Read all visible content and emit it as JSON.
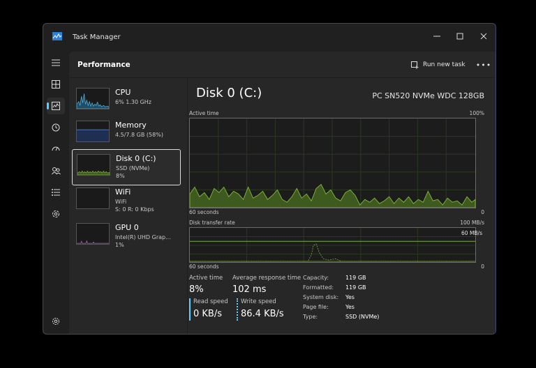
{
  "app": {
    "title": "Task Manager"
  },
  "header": {
    "page_title": "Performance",
    "run_new_task": "Run new task"
  },
  "resources": [
    {
      "name": "CPU",
      "sub1": "6% 1.30 GHz",
      "sub2": ""
    },
    {
      "name": "Memory",
      "sub1": "4.5/7.8 GB (58%)",
      "sub2": ""
    },
    {
      "name": "Disk 0 (C:)",
      "sub1": "SSD (NVMe)",
      "sub2": "8%"
    },
    {
      "name": "WiFi",
      "sub1": "WiFi",
      "sub2": "S: 0 R: 0 Kbps"
    },
    {
      "name": "GPU 0",
      "sub1": "Intel(R) UHD Grap...",
      "sub2": "1%"
    }
  ],
  "detail": {
    "title": "Disk 0 (C:)",
    "model": "PC SN520 NVMe WDC 128GB",
    "active_time_graph": {
      "label": "Active time",
      "max": "100%",
      "time": "60 seconds",
      "min": "0"
    },
    "transfer_graph": {
      "label": "Disk transfer rate",
      "max": "100 MB/s",
      "ref": "60 MB/s",
      "time": "60 seconds",
      "min": "0"
    },
    "stats": {
      "active_time_label": "Active time",
      "active_time": "8%",
      "avg_response_label": "Average response time",
      "avg_response": "102 ms",
      "read_speed_label": "Read speed",
      "read_speed": "0 KB/s",
      "write_speed_label": "Write speed",
      "write_speed": "86.4 KB/s"
    },
    "properties": [
      {
        "key": "Capacity:",
        "value": "119 GB"
      },
      {
        "key": "Formatted:",
        "value": "119 GB"
      },
      {
        "key": "System disk:",
        "value": "Yes"
      },
      {
        "key": "Page file:",
        "value": "Yes"
      },
      {
        "key": "Type:",
        "value": "SSD (NVMe)"
      }
    ]
  },
  "colors": {
    "accent": "#60cdff",
    "disk_line": "#7cae3a",
    "disk_fill": "#3e5a1e",
    "cpu_line": "#4fb0d9",
    "memory_line": "#5a7cc9",
    "gpu_line": "#b068c9"
  },
  "icons": {
    "rail": [
      "hamburger-icon",
      "processes-icon",
      "performance-icon",
      "app-history-icon",
      "startup-apps-icon",
      "users-icon",
      "details-icon",
      "services-icon",
      "settings-icon"
    ]
  }
}
